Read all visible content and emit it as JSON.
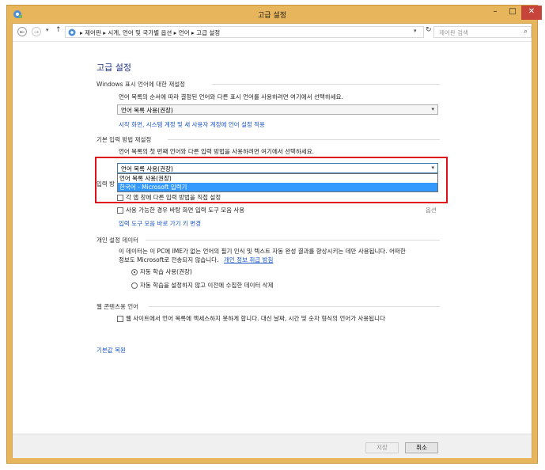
{
  "window": {
    "title": "고급 설정",
    "min_symbol": "–",
    "max_symbol": "□",
    "close_symbol": "✕"
  },
  "nav": {
    "back": "←",
    "forward": "→",
    "dropdown": "▾",
    "up": "↑",
    "breadcrumbs": "▸ 제어판 ▸ 시계, 언어 및 국가별 옵션 ▸ 언어 ▸ 고급 설정",
    "address_dropdown": "▾",
    "refresh": "↻",
    "search_placeholder": "제어판 검색",
    "search_icon": "⌕"
  },
  "page": {
    "heading": "고급 설정",
    "display_language": {
      "title": "Windows 표시 언어에 대한 재설정",
      "description": "언어 목록의 순서에 따라 결정된 언어와 다른 표시 언어를 사용하려면 여기에서 선택하세요.",
      "select_value": "언어 목록 사용(권장)",
      "link": "시작 화면, 시스템 계정 및 새 사용자 계정에 언어 설정 적용"
    },
    "input_method": {
      "title": "기본 입력 방법 재설정",
      "description": "언어 목록의 첫 번째 언어와 다른 입력 방법을 사용하려면 여기에서 선택하세요.",
      "select_value": "언어 목록 사용(권장)",
      "options": [
        "언어 목록 사용(권장)",
        "한국어 - Microsoft 입력기"
      ],
      "selected_index": 1
    },
    "switching": {
      "title_partial": "입력 방",
      "per_app_label": "각 앱 창에 다른 입력 방법을 직접 설정",
      "desktop_bar_label": "사용 가능한 경우 바탕 화면 입력 도구 모음 사용",
      "options_link": "옵션",
      "hotkeys_link": "입력 도구 모음 바로 가기 키 변경"
    },
    "personalization": {
      "title": "개인 설정 데이터",
      "description_line1": "이 데이터는 이 PC에 IME가 없는 언어의 필기 인식 및 텍스트 자동 완성 결과를 향상시키는 데만 사용됩니다. 어떠한",
      "description_line2": "정보도 Microsoft로 전송되지 않습니다.",
      "privacy_link": "개인 정보 취급 방침",
      "radio_auto": "자동 학습 사용(권장)",
      "radio_off": "자동 학습을 설정하지 않고 이전에 수집한 데이터 삭제",
      "radio_selected": "auto"
    },
    "web_content": {
      "title": "웹 콘텐츠용 언어",
      "checkbox_label": "웹 사이트에서 언어 목록에 액세스하지 못하게 합니다. 대신 날짜, 시간 및 숫자 형식의 언어가 사용됩니다"
    },
    "restore_defaults": "기본값 복원"
  },
  "footer": {
    "save": "저장",
    "cancel": "취소"
  },
  "colors": {
    "window_frame": "#e7b55b",
    "close_button": "#c7443b",
    "heading": "#1e3287",
    "link": "#1a56c9",
    "highlight_box": "#e0101a",
    "selection": "#3399ff"
  }
}
